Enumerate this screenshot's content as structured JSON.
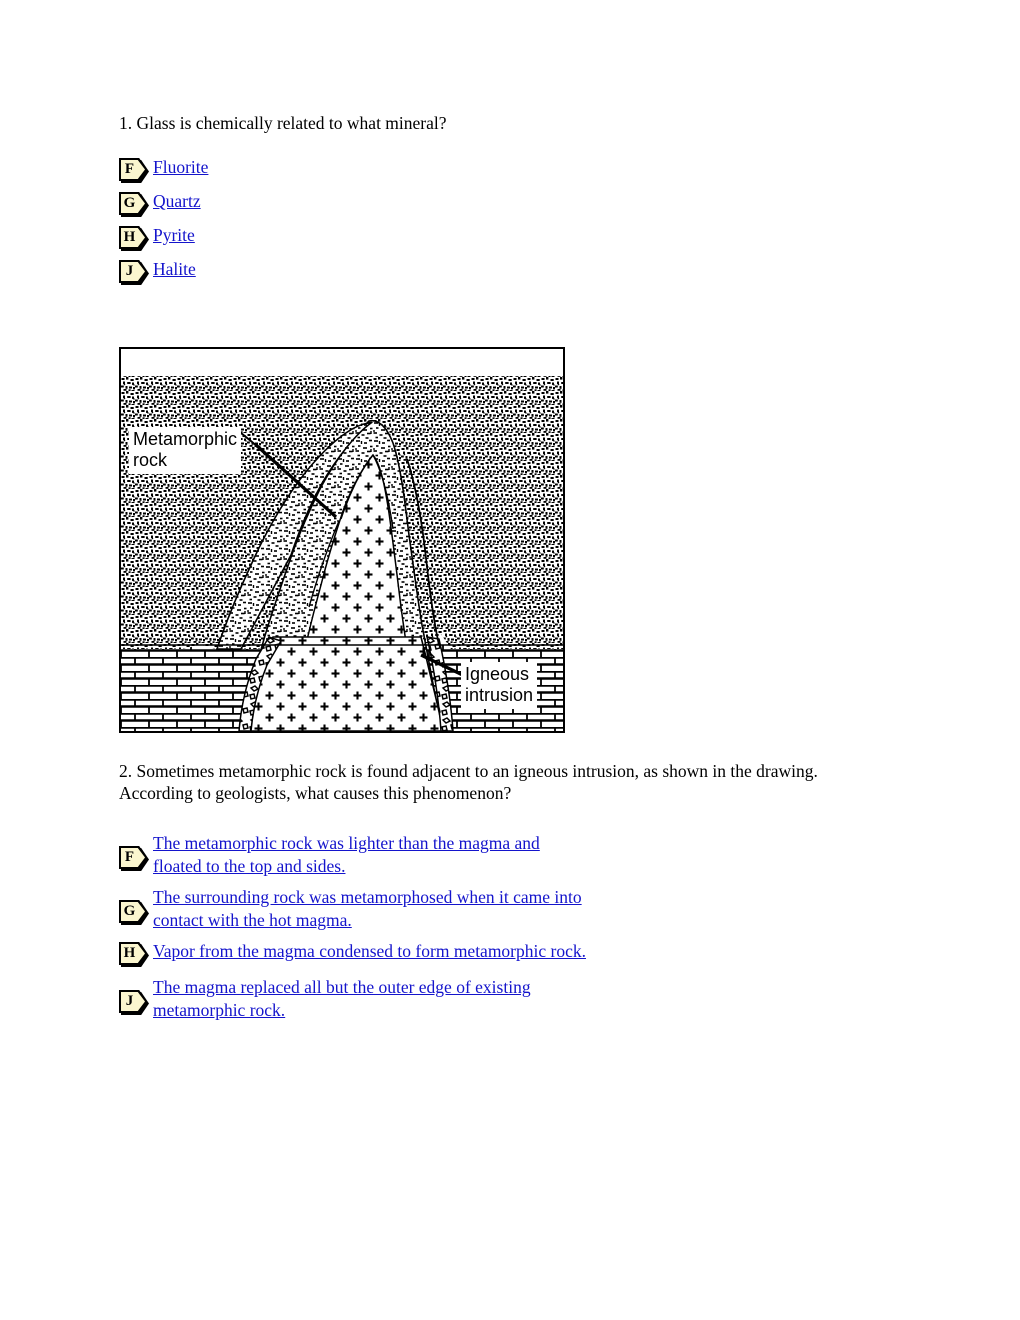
{
  "document": {
    "type": "science-quiz-worksheet",
    "link_color": "#1414cc",
    "bullet_fill_color": "#fbf6cf"
  },
  "question1": {
    "number": "1.",
    "text": "1. Glass is chemically related to what mineral?",
    "choices": [
      {
        "letter": "F",
        "label": "Fluorite"
      },
      {
        "letter": "G",
        "label": "Quartz"
      },
      {
        "letter": "H",
        "label": "Pyrite"
      },
      {
        "letter": "J",
        "label": "Halite"
      }
    ]
  },
  "figure": {
    "alt": "Cross-section diagram of an igneous intrusion surrounded by metamorphic rock",
    "labels": {
      "metamorphic": "Metamorphic\nrock",
      "igneous": "Igneous\nintrusion"
    }
  },
  "question2": {
    "number": "2.",
    "text": "2. Sometimes metamorphic rock is found adjacent to an igneous intrusion, as shown in the drawing. According to geologists, what causes this phenomenon?",
    "choices": [
      {
        "letter": "F",
        "label": "The metamorphic rock was lighter than the magma and floated to the top and sides."
      },
      {
        "letter": "G",
        "label": "The surrounding rock was metamorphosed when it came into contact with the hot magma."
      },
      {
        "letter": "H",
        "label": "Vapor from the magma condensed to form metamorphic rock."
      },
      {
        "letter": "J",
        "label": "The magma replaced all but the outer edge of existing metamorphic rock."
      }
    ]
  }
}
